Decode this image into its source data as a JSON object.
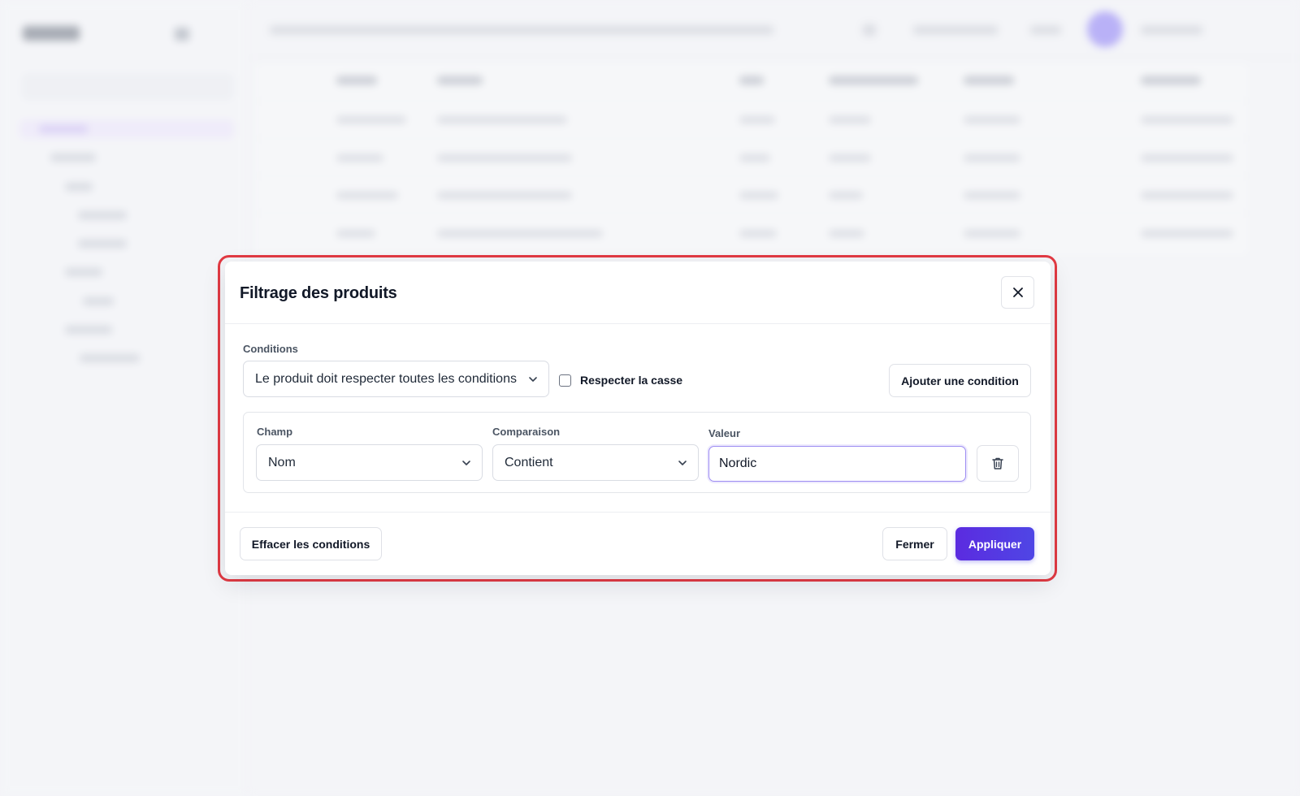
{
  "modal": {
    "title": "Filtrage des produits",
    "close_icon": "close-icon",
    "conditions_label": "Conditions",
    "match_mode": {
      "selected": "Le produit doit respecter toutes les conditions"
    },
    "case_sensitive": {
      "label": "Respecter la casse",
      "checked": false
    },
    "add_condition_label": "Ajouter une condition",
    "condition": {
      "field_label": "Champ",
      "field_value": "Nom",
      "comparison_label": "Comparaison",
      "comparison_value": "Contient",
      "value_label": "Valeur",
      "value": "Nordic",
      "delete_icon": "trash-icon"
    },
    "footer": {
      "clear_label": "Effacer les conditions",
      "close_label": "Fermer",
      "apply_label": "Appliquer"
    }
  },
  "colors": {
    "accent": "#5b2be0",
    "highlight_outline": "#e23a43",
    "focus_ring": "#9d8cf2"
  }
}
